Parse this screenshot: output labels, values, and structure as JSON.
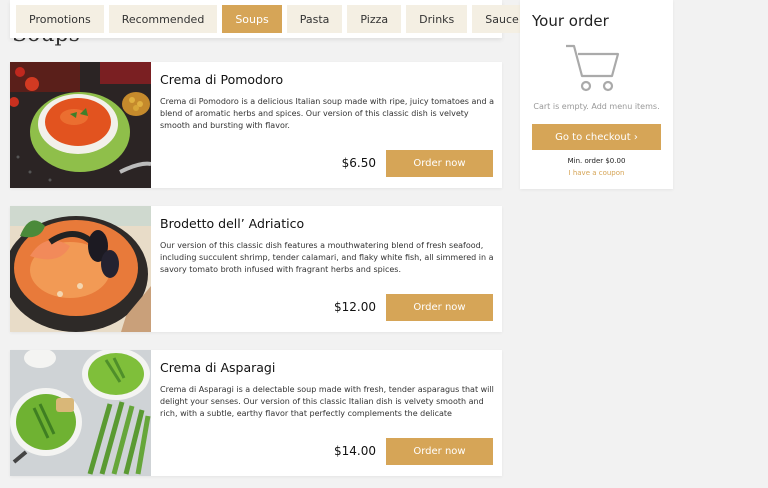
{
  "section": {
    "title": "Soups"
  },
  "categories": [
    {
      "label": "Promotions"
    },
    {
      "label": "Recommended"
    },
    {
      "label": "Soups"
    },
    {
      "label": "Pasta"
    },
    {
      "label": "Pizza"
    },
    {
      "label": "Drinks"
    },
    {
      "label": "Sauce"
    }
  ],
  "active_category": "Soups",
  "menu_items": [
    {
      "name": "Crema di Pomodoro",
      "description": "Crema di Pomodoro is a delicious Italian soup made with ripe, juicy tomatoes and a blend of aromatic herbs and spices. Our version of this classic dish is velvety smooth and bursting with flavor.",
      "price": "$6.50",
      "button": "Order now"
    },
    {
      "name": "Brodetto dell’ Adriatico",
      "description": "Our version of this classic dish features a mouthwatering blend of fresh seafood, including succulent shrimp, tender calamari, and flaky white fish, all simmered in a savory tomato broth infused with fragrant herbs and spices.",
      "price": "$12.00",
      "button": "Order now"
    },
    {
      "name": "Crema di Asparagi",
      "description": "Crema di Asparagi is a delectable soup made with fresh, tender asparagus that will delight your senses. Our version of this classic Italian dish is velvety smooth and rich, with a subtle, earthy flavor that perfectly complements the delicate sweetness of th...",
      "price": "$14.00",
      "button": "Order now"
    }
  ],
  "order": {
    "title": "Your order",
    "empty_text": "Cart is empty. Add menu items.",
    "checkout_label": "Go to checkout ›",
    "min_order": "Min. order $0.00",
    "coupon": "I have a coupon"
  },
  "colors": {
    "accent": "#d6a557",
    "tab_bg": "#f4efe3",
    "page_bg": "#f2f2f2"
  }
}
